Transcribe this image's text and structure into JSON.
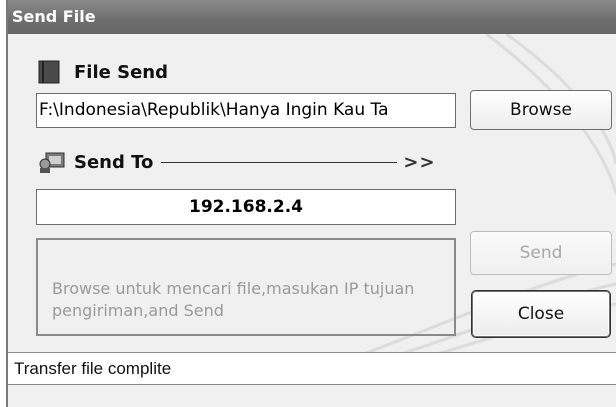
{
  "window": {
    "title": "Send File"
  },
  "file_section": {
    "label": "File Send",
    "icon": "book-icon",
    "path_value": "F:\\Indonesia\\Republik\\Hanya Ingin Kau Ta",
    "browse_label": "Browse"
  },
  "send_to": {
    "label": "Send To",
    "icon": "computer-user-icon",
    "arrows": ">>",
    "ip_value": "192.168.2.4"
  },
  "info": {
    "text": "Browse untuk mencari file,masukan IP tujuan pengiriman,and Send"
  },
  "buttons": {
    "send_label": "Send",
    "send_enabled": false,
    "close_label": "Close"
  },
  "status": {
    "text": "Transfer file complite"
  }
}
